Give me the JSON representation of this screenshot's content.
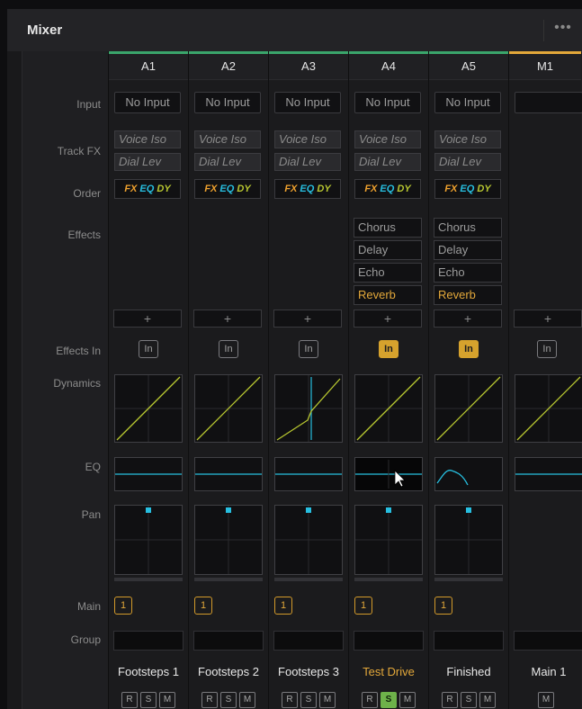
{
  "window": {
    "title": "Mixer",
    "more_icon": "more-dots-icon",
    "more_label": "•••"
  },
  "row_labels": {
    "input": "Input",
    "track_fx": "Track FX",
    "order": "Order",
    "effects": "Effects",
    "effects_in": "Effects In",
    "dynamics": "Dynamics",
    "eq": "EQ",
    "pan": "Pan",
    "main": "Main",
    "group": "Group"
  },
  "order_tags": {
    "fx": "FX",
    "eq": "EQ",
    "dy": "DY"
  },
  "add_label": "+",
  "in_label": "In",
  "tracks": [
    {
      "id": "A1",
      "input": "No Input",
      "fx": [
        "Voice Iso",
        "Dial Lev"
      ],
      "effects": [],
      "effects_in": false,
      "dyn": "linear",
      "eq": "flat",
      "main": "1",
      "name": "Footsteps 1",
      "buttons": [
        "R",
        "S",
        "M"
      ],
      "solo": false,
      "name_active": false
    },
    {
      "id": "A2",
      "input": "No Input",
      "fx": [
        "Voice Iso",
        "Dial Lev"
      ],
      "effects": [],
      "effects_in": false,
      "dyn": "linear",
      "eq": "flat",
      "main": "1",
      "name": "Footsteps 2",
      "buttons": [
        "R",
        "S",
        "M"
      ],
      "solo": false,
      "name_active": false
    },
    {
      "id": "A3",
      "input": "No Input",
      "fx": [
        "Voice Iso",
        "Dial Lev"
      ],
      "effects": [],
      "effects_in": false,
      "dyn": "gate",
      "eq": "flat",
      "main": "1",
      "name": "Footsteps 3",
      "buttons": [
        "R",
        "S",
        "M"
      ],
      "solo": false,
      "name_active": false
    },
    {
      "id": "A4",
      "input": "No Input",
      "fx": [
        "Voice Iso",
        "Dial Lev"
      ],
      "effects": [
        "Chorus",
        "Delay",
        "Echo",
        "Reverb"
      ],
      "effects_in": true,
      "dyn": "linear",
      "eq": "flat",
      "main": "1",
      "name": "Test Drive",
      "buttons": [
        "R",
        "S",
        "M"
      ],
      "solo": true,
      "name_active": true
    },
    {
      "id": "A5",
      "input": "No Input",
      "fx": [
        "Voice Iso",
        "Dial Lev"
      ],
      "effects": [
        "Chorus",
        "Delay",
        "Echo",
        "Reverb"
      ],
      "effects_in": true,
      "dyn": "linear",
      "eq": "peak",
      "main": "1",
      "name": "Finished",
      "buttons": [
        "R",
        "S",
        "M"
      ],
      "solo": false,
      "name_active": false
    },
    {
      "id": "M1",
      "input": "",
      "fx": [],
      "effects": [],
      "effects_in": false,
      "dyn": "linear",
      "eq": "flat",
      "main": "",
      "name": "Main 1",
      "buttons": [
        "M"
      ],
      "solo": false,
      "name_active": false
    }
  ],
  "colors": {
    "accent": "#e3a83a",
    "eq_line": "#27bfe0",
    "dyn_line": "#b8c730",
    "solo": "#6eb24a",
    "track_top": "#3aa56b"
  }
}
